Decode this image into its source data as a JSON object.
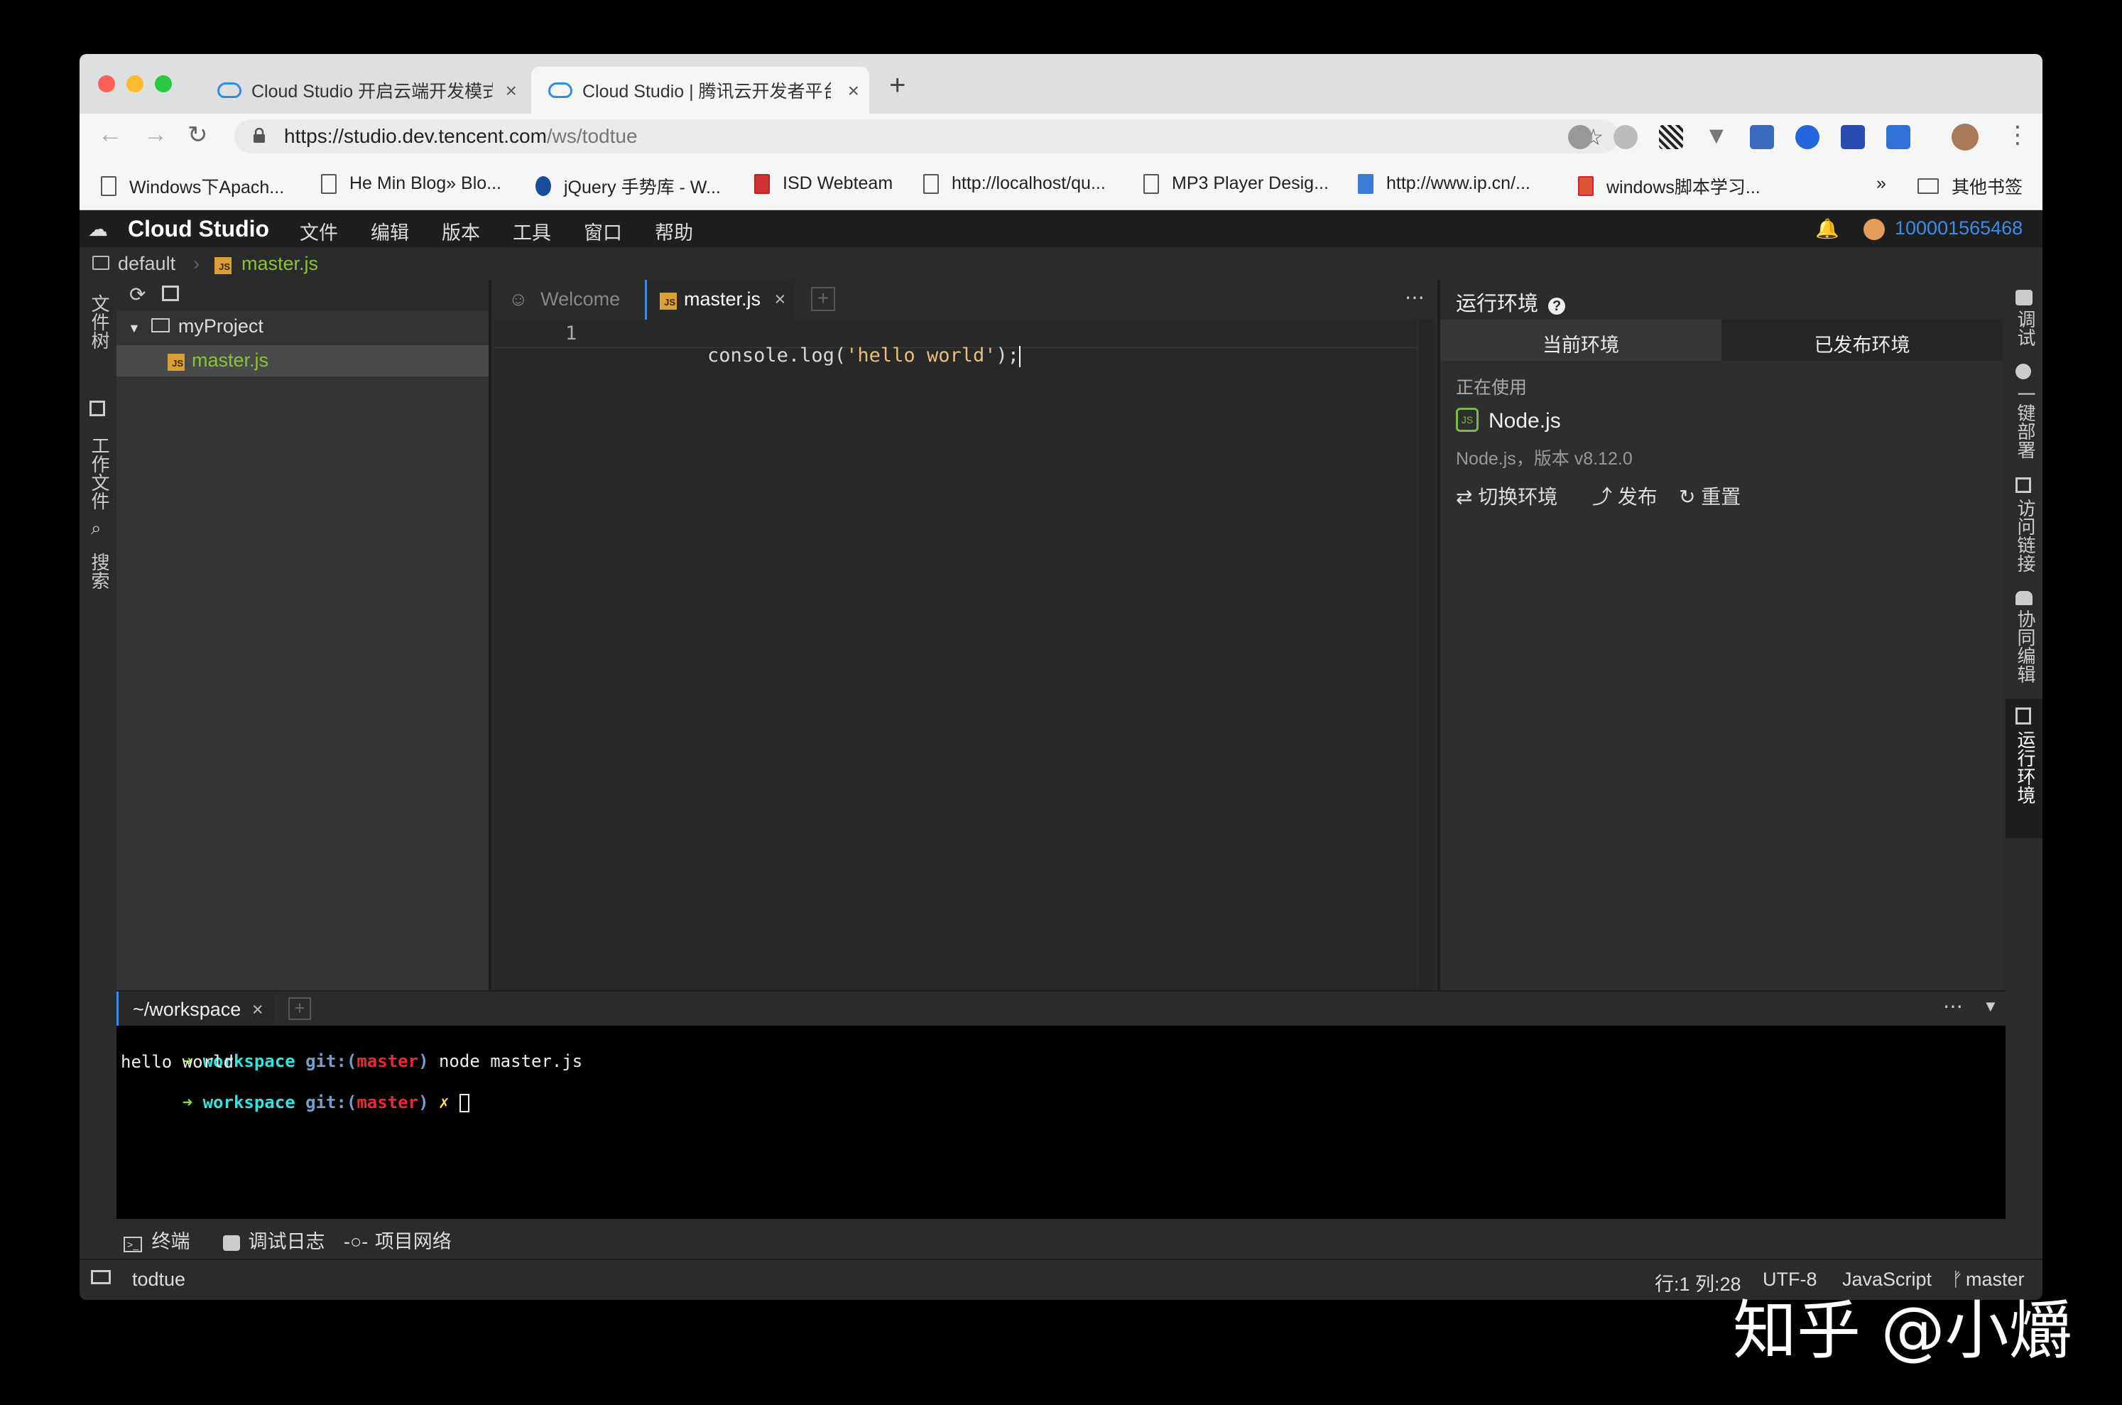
{
  "browser": {
    "tabs": [
      {
        "title": "Cloud Studio 开启云端开发模式"
      },
      {
        "title": "Cloud Studio | 腾讯云开发者平台"
      }
    ],
    "url_host": "https://studio.dev.tencent.com",
    "url_path": "/ws/todtue",
    "bookmarks": [
      "Windows下Apach...",
      "He Min Blog» Blo...",
      "jQuery 手势库 - W...",
      "ISD Webteam",
      "http://localhost/qu...",
      "MP3 Player Desig...",
      "http://www.ip.cn/...",
      "windows脚本学习...",
      "»",
      "其他书签"
    ]
  },
  "ide": {
    "brand": "Cloud Studio",
    "menu": [
      "文件",
      "编辑",
      "版本",
      "工具",
      "窗口",
      "帮助"
    ],
    "user_id": "100001565468",
    "breadcrumb": {
      "root": "default",
      "file": "master.js"
    },
    "left_sidebar": [
      "文件树",
      "工作文件",
      "搜索"
    ],
    "explorer": {
      "project": "myProject",
      "file": "master.js"
    },
    "editor_tabs": [
      {
        "label": "Welcome"
      },
      {
        "label": "master.js"
      }
    ],
    "code": {
      "line_number": "1",
      "fn": "console",
      "dot": ".",
      "method": "log",
      "open": "(",
      "string": "'hello world'",
      "close": ");"
    },
    "runtime": {
      "title": "运行环境",
      "tabs": [
        "当前环境",
        "已发布环境"
      ],
      "in_use_label": "正在使用",
      "env_name": "Node.js",
      "env_version": "Node.js，版本 v8.12.0",
      "actions": [
        "切换环境",
        "发布",
        "重置"
      ]
    },
    "right_sidebar": [
      "调试",
      "一键部署",
      "访问链接",
      "协同编辑",
      "运行环境"
    ],
    "terminal": {
      "tab": "~/workspace",
      "line1": {
        "arrow": "➜",
        "dir": "workspace",
        "git": "git:(",
        "branch": "master",
        "git_close": ")",
        "cmd": "node master.js"
      },
      "line2": "hello world",
      "line3": {
        "arrow": "➜",
        "dir": "workspace",
        "git": "git:(",
        "branch": "master",
        "git_close": ")",
        "dirty": "✗"
      }
    },
    "bottom_tabs": [
      "终端",
      "调试日志",
      "项目网络"
    ],
    "status": {
      "workspace": "todtue",
      "position": "行:1 列:28",
      "encoding": "UTF-8",
      "language": "JavaScript",
      "branch": "master"
    }
  },
  "watermark": "知乎 @小爝"
}
